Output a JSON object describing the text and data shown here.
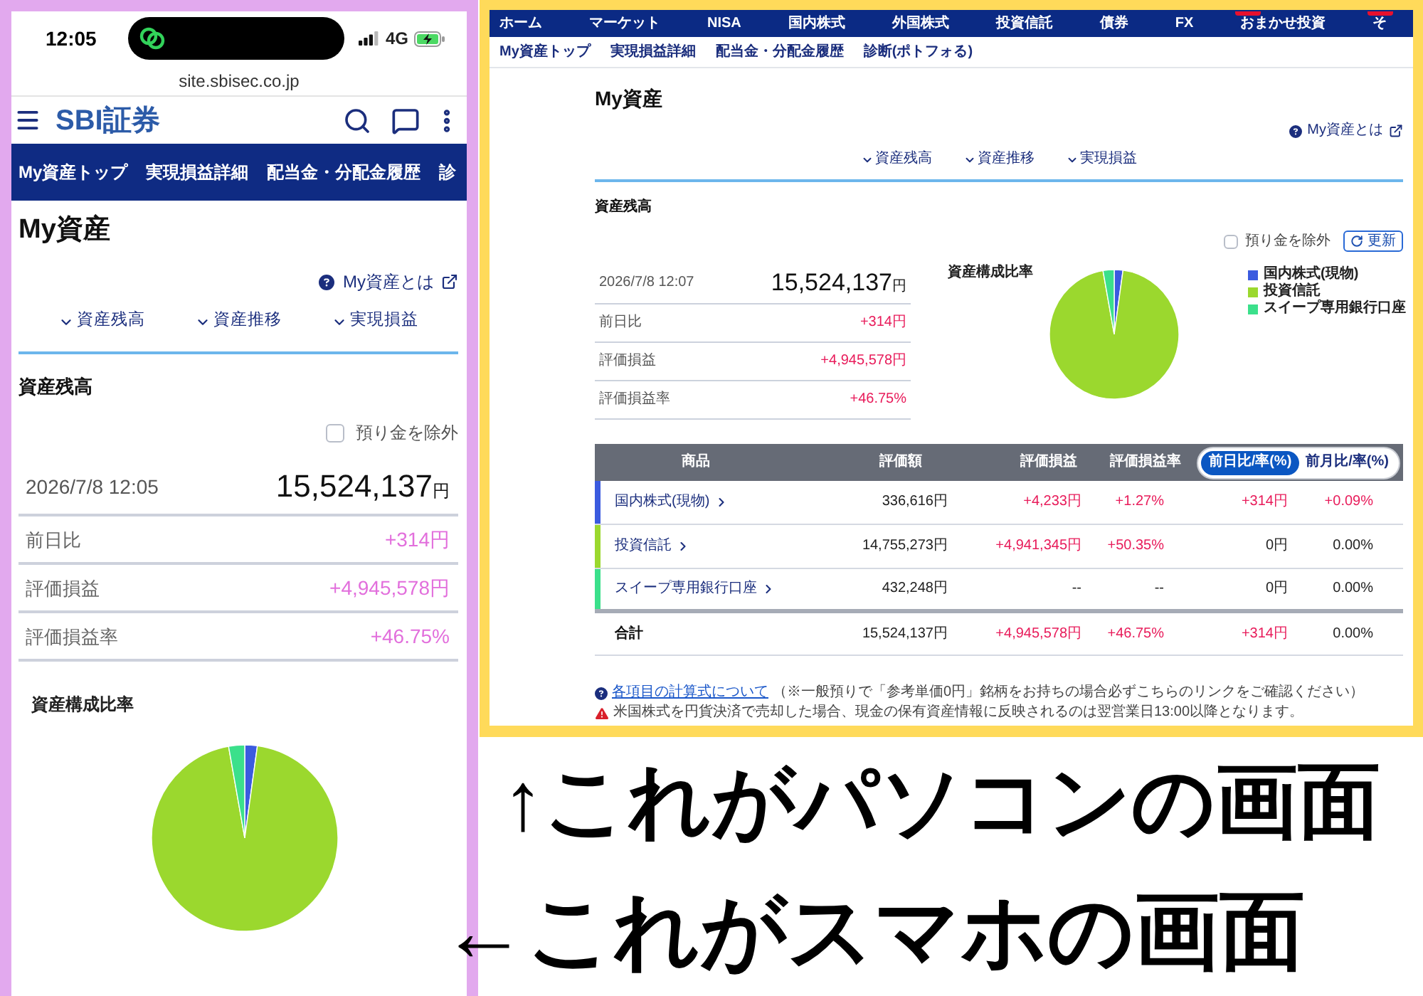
{
  "phone": {
    "status_bar": {
      "time": "12:05",
      "network": "4G"
    },
    "address_bar": {
      "url": "site.sbisec.co.jp"
    },
    "header": {
      "logo": "SBI証券"
    },
    "nav_tabs": [
      {
        "label": "My資産トップ"
      },
      {
        "label": "実現損益詳細"
      },
      {
        "label": "配当金・分配金履歴"
      },
      {
        "label": "診"
      }
    ],
    "page_title": "My資産",
    "help_link": "My資産とは",
    "section_links": [
      {
        "label": "資産残高"
      },
      {
        "label": "資産推移"
      },
      {
        "label": "実現損益"
      }
    ],
    "balance": {
      "title": "資産残高",
      "exclude_deposits": {
        "label": "預り金を除外",
        "checked": false
      },
      "timestamp": "2026/7/8 12:05",
      "total": {
        "amount": "15,524,137",
        "unit": "円"
      },
      "rows": [
        {
          "label": "前日比",
          "value": "+314円"
        },
        {
          "label": "評価損益",
          "value": "+4,945,578円"
        },
        {
          "label": "評価損益率",
          "value": "+46.75%"
        }
      ],
      "chart_data": {
        "type": "pie",
        "title": "資産構成比率",
        "values": [
          2.17,
          95.05,
          2.78
        ],
        "colors": [
          "#3b5bdf",
          "#9bd82e",
          "#3be08b"
        ]
      }
    }
  },
  "desktop": {
    "main_nav": [
      {
        "label": "ホーム",
        "tagged": false
      },
      {
        "label": "マーケット",
        "tagged": false
      },
      {
        "label": "NISA",
        "tagged": false
      },
      {
        "label": "国内株式",
        "tagged": false
      },
      {
        "label": "外国株式",
        "tagged": false
      },
      {
        "label": "投資信託",
        "tagged": false
      },
      {
        "label": "債券",
        "tagged": false
      },
      {
        "label": "FX",
        "tagged": false
      },
      {
        "label": "おまかせ投資",
        "tagged": true
      },
      {
        "label": "そ",
        "tagged": true
      }
    ],
    "sub_nav": [
      {
        "label": "My資産トップ"
      },
      {
        "label": "実現損益詳細"
      },
      {
        "label": "配当金・分配金履歴"
      },
      {
        "label": "診断(ポトフォる)"
      }
    ],
    "page_title": "My資産",
    "help_link": "My資産とは",
    "section_links": [
      {
        "label": "資産残高"
      },
      {
        "label": "資産推移"
      },
      {
        "label": "実現損益"
      }
    ],
    "balance": {
      "title": "資産残高",
      "exclude_deposits": {
        "label": "預り金を除外",
        "checked": false
      },
      "refresh_button": "更新",
      "timestamp": "2026/7/8 12:07",
      "total": {
        "amount": "15,524,137",
        "unit": "円"
      },
      "rows": [
        {
          "label": "前日比",
          "value": "+314円"
        },
        {
          "label": "評価損益",
          "value": "+4,945,578円"
        },
        {
          "label": "評価損益率",
          "value": "+46.75%"
        }
      ],
      "chart_data": {
        "type": "pie",
        "title": "資産構成比率",
        "categories": [
          "国内株式(現物)",
          "投資信託",
          "スイープ専用銀行口座"
        ],
        "values": [
          2.17,
          95.05,
          2.78
        ],
        "colors": [
          "#3b5bdf",
          "#9bd82e",
          "#3be08b"
        ]
      }
    },
    "table": {
      "columns": [
        "商品",
        "評価額",
        "評価損益",
        "評価損益率"
      ],
      "toggle": [
        {
          "label": "前日比/率(%)",
          "selected": true
        },
        {
          "label": "前月比/率(%)",
          "selected": false
        }
      ],
      "rows": [
        {
          "color": "#3b5bdf",
          "cells": [
            {
              "text": "国内株式(現物)",
              "kind": "link"
            },
            {
              "text": "336,616円",
              "kind": "plain"
            },
            {
              "text": "+4,233円",
              "kind": "gain"
            },
            {
              "text": "+1.27%",
              "kind": "gain"
            },
            {
              "text": "+314円",
              "kind": "gain"
            },
            {
              "text": "+0.09%",
              "kind": "gain"
            }
          ]
        },
        {
          "color": "#9bd82e",
          "cells": [
            {
              "text": "投資信託",
              "kind": "link"
            },
            {
              "text": "14,755,273円",
              "kind": "plain"
            },
            {
              "text": "+4,941,345円",
              "kind": "gain"
            },
            {
              "text": "+50.35%",
              "kind": "gain"
            },
            {
              "text": "0円",
              "kind": "plain"
            },
            {
              "text": "0.00%",
              "kind": "plain"
            }
          ]
        },
        {
          "color": "#3be08b",
          "cells": [
            {
              "text": "スイープ専用銀行口座",
              "kind": "link"
            },
            {
              "text": "432,248円",
              "kind": "plain"
            },
            {
              "text": "--",
              "kind": "plain"
            },
            {
              "text": "--",
              "kind": "plain"
            },
            {
              "text": "0円",
              "kind": "plain"
            },
            {
              "text": "0.00%",
              "kind": "plain"
            }
          ]
        }
      ],
      "total": {
        "cells": [
          {
            "text": "合計",
            "kind": "label"
          },
          {
            "text": "15,524,137円",
            "kind": "plain"
          },
          {
            "text": "+4,945,578円",
            "kind": "gain"
          },
          {
            "text": "+46.75%",
            "kind": "gain"
          },
          {
            "text": "+314円",
            "kind": "gain"
          },
          {
            "text": "0.00%",
            "kind": "plain"
          }
        ]
      }
    },
    "notes": [
      {
        "kind": "info",
        "link": "各項目の計算式について",
        "text": "（※一般預りで「参考単価0円」銘柄をお持ちの場合必ずこちらのリンクをご確認ください）"
      },
      {
        "kind": "warning",
        "text": "米国株式を円貨決済で売却した場合、現金の保有資産情報に反映されるのは翌営業日13:00以降となります。"
      }
    ]
  },
  "captions": [
    {
      "text": "↑これがパソコンの画面"
    },
    {
      "text": "←これがスマホの画面"
    }
  ]
}
